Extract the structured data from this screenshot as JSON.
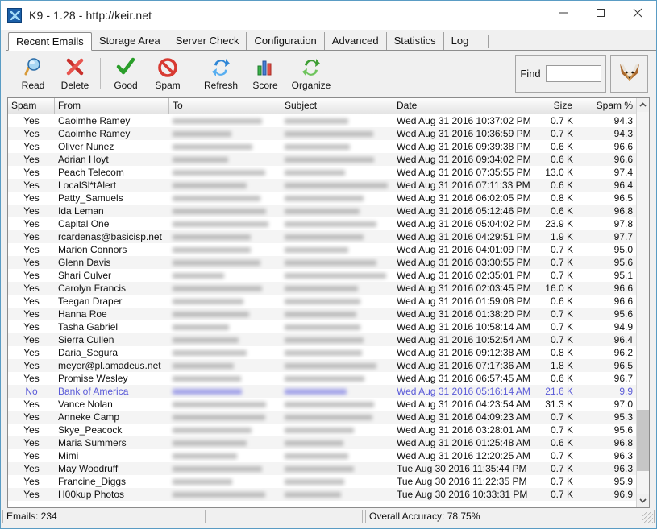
{
  "window": {
    "title": "K9 - 1.28 - http://keir.net",
    "app_icon": "k9-app-icon",
    "minimize_label": "Minimize",
    "maximize_label": "Maximize",
    "close_label": "Close"
  },
  "tabs": [
    {
      "label": "Recent Emails",
      "active": true
    },
    {
      "label": "Storage Area",
      "active": false
    },
    {
      "label": "Server Check",
      "active": false
    },
    {
      "label": "Configuration",
      "active": false
    },
    {
      "label": "Advanced",
      "active": false
    },
    {
      "label": "Statistics",
      "active": false
    },
    {
      "label": "Log",
      "active": false
    }
  ],
  "toolbar": {
    "buttons": [
      {
        "label": "Read",
        "icon": "magnifier-icon"
      },
      {
        "label": "Delete",
        "icon": "red-x-icon"
      },
      {
        "label": "Good",
        "icon": "green-check-icon"
      },
      {
        "label": "Spam",
        "icon": "red-prohibition-icon"
      },
      {
        "label": "Refresh",
        "icon": "blue-refresh-arrows-icon"
      },
      {
        "label": "Score",
        "icon": "bar-chart-icon"
      },
      {
        "label": "Organize",
        "icon": "green-recycle-arrows-icon"
      }
    ],
    "find_label": "Find",
    "find_value": "",
    "find_placeholder": "",
    "fox_icon": "fox-head-icon"
  },
  "table": {
    "columns": [
      "Spam",
      "From",
      "To",
      "Subject",
      "Date",
      "Size",
      "Spam %"
    ],
    "selected_color": "#5a5ad8",
    "rows": [
      {
        "spam": "Yes",
        "from": "Caoimhe Ramey",
        "to": "",
        "subject": "",
        "date": "Wed Aug 31 2016  10:37:02 PM",
        "size": "0.7 K",
        "spam_pct": "94.3",
        "selected": false
      },
      {
        "spam": "Yes",
        "from": "Caoimhe Ramey",
        "to": "",
        "subject": "",
        "date": "Wed Aug 31 2016  10:36:59 PM",
        "size": "0.7 K",
        "spam_pct": "94.3",
        "selected": false
      },
      {
        "spam": "Yes",
        "from": "Oliver Nunez",
        "to": "",
        "subject": "",
        "date": "Wed Aug 31 2016  09:39:38 PM",
        "size": "0.6 K",
        "spam_pct": "96.6",
        "selected": false
      },
      {
        "spam": "Yes",
        "from": "Adrian Hoyt",
        "to": "",
        "subject": "",
        "date": "Wed Aug 31 2016  09:34:02 PM",
        "size": "0.6 K",
        "spam_pct": "96.6",
        "selected": false
      },
      {
        "spam": "Yes",
        "from": "Peach Telecom",
        "to": "",
        "subject": "",
        "date": "Wed Aug 31 2016  07:35:55 PM",
        "size": "13.0 K",
        "spam_pct": "97.4",
        "selected": false
      },
      {
        "spam": "Yes",
        "from": "LocalSl*tAlert",
        "to": "",
        "subject": "",
        "date": "Wed Aug 31 2016  07:11:33 PM",
        "size": "0.6 K",
        "spam_pct": "96.4",
        "selected": false
      },
      {
        "spam": "Yes",
        "from": "Patty_Samuels",
        "to": "",
        "subject": "",
        "date": "Wed Aug 31 2016  06:02:05 PM",
        "size": "0.8 K",
        "spam_pct": "96.5",
        "selected": false
      },
      {
        "spam": "Yes",
        "from": "Ida Leman",
        "to": "",
        "subject": "",
        "date": "Wed Aug 31 2016  05:12:46 PM",
        "size": "0.6 K",
        "spam_pct": "96.8",
        "selected": false
      },
      {
        "spam": "Yes",
        "from": "Capital One",
        "to": "",
        "subject": "",
        "date": "Wed Aug 31 2016  05:04:02 PM",
        "size": "23.9 K",
        "spam_pct": "97.8",
        "selected": false
      },
      {
        "spam": "Yes",
        "from": "rcardenas@basicisp.net",
        "to": "",
        "subject": "",
        "date": "Wed Aug 31 2016  04:29:51 PM",
        "size": "1.9 K",
        "spam_pct": "97.7",
        "selected": false
      },
      {
        "spam": "Yes",
        "from": "Marion Connors",
        "to": "",
        "subject": "",
        "date": "Wed Aug 31 2016  04:01:09 PM",
        "size": "0.7 K",
        "spam_pct": "95.0",
        "selected": false
      },
      {
        "spam": "Yes",
        "from": "Glenn Davis",
        "to": "",
        "subject": "",
        "date": "Wed Aug 31 2016  03:30:55 PM",
        "size": "0.7 K",
        "spam_pct": "95.6",
        "selected": false
      },
      {
        "spam": "Yes",
        "from": "Shari Culver",
        "to": "",
        "subject": "",
        "date": "Wed Aug 31 2016  02:35:01 PM",
        "size": "0.7 K",
        "spam_pct": "95.1",
        "selected": false
      },
      {
        "spam": "Yes",
        "from": "Carolyn Francis",
        "to": "",
        "subject": "",
        "date": "Wed Aug 31 2016  02:03:45 PM",
        "size": "16.0 K",
        "spam_pct": "96.6",
        "selected": false
      },
      {
        "spam": "Yes",
        "from": "Teegan Draper",
        "to": "",
        "subject": "",
        "date": "Wed Aug 31 2016  01:59:08 PM",
        "size": "0.6 K",
        "spam_pct": "96.6",
        "selected": false
      },
      {
        "spam": "Yes",
        "from": "Hanna Roe",
        "to": "",
        "subject": "",
        "date": "Wed Aug 31 2016  01:38:20 PM",
        "size": "0.7 K",
        "spam_pct": "95.6",
        "selected": false
      },
      {
        "spam": "Yes",
        "from": "Tasha Gabriel",
        "to": "",
        "subject": "",
        "date": "Wed Aug 31 2016  10:58:14 AM",
        "size": "0.7 K",
        "spam_pct": "94.9",
        "selected": false
      },
      {
        "spam": "Yes",
        "from": "Sierra Cullen",
        "to": "",
        "subject": "",
        "date": "Wed Aug 31 2016  10:52:54 AM",
        "size": "0.7 K",
        "spam_pct": "96.4",
        "selected": false
      },
      {
        "spam": "Yes",
        "from": "Daria_Segura",
        "to": "",
        "subject": "",
        "date": "Wed Aug 31 2016  09:12:38 AM",
        "size": "0.8 K",
        "spam_pct": "96.2",
        "selected": false
      },
      {
        "spam": "Yes",
        "from": "meyer@pl.amadeus.net",
        "to": "",
        "subject": "",
        "date": "Wed Aug 31 2016  07:17:36 AM",
        "size": "1.8 K",
        "spam_pct": "96.5",
        "selected": false
      },
      {
        "spam": "Yes",
        "from": "Promise Wesley",
        "to": "",
        "subject": "",
        "date": "Wed Aug 31 2016  06:57:45 AM",
        "size": "0.6 K",
        "spam_pct": "96.7",
        "selected": false
      },
      {
        "spam": "No",
        "from": "Bank of America",
        "to": "",
        "subject": "",
        "date": "Wed Aug 31 2016  05:16:14 AM",
        "size": "21.6 K",
        "spam_pct": "9.9",
        "selected": true
      },
      {
        "spam": "Yes",
        "from": "Vance Nolan",
        "to": "",
        "subject": "",
        "date": "Wed Aug 31 2016  04:23:54 AM",
        "size": "31.3 K",
        "spam_pct": "97.0",
        "selected": false
      },
      {
        "spam": "Yes",
        "from": "Anneke Camp",
        "to": "",
        "subject": "",
        "date": "Wed Aug 31 2016  04:09:23 AM",
        "size": "0.7 K",
        "spam_pct": "95.3",
        "selected": false
      },
      {
        "spam": "Yes",
        "from": "Skye_Peacock",
        "to": "",
        "subject": "",
        "date": "Wed Aug 31 2016  03:28:01 AM",
        "size": "0.7 K",
        "spam_pct": "95.6",
        "selected": false
      },
      {
        "spam": "Yes",
        "from": "Maria Summers",
        "to": "",
        "subject": "",
        "date": "Wed Aug 31 2016  01:25:48 AM",
        "size": "0.6 K",
        "spam_pct": "96.8",
        "selected": false
      },
      {
        "spam": "Yes",
        "from": "Mimi",
        "to": "",
        "subject": "",
        "date": "Wed Aug 31 2016  12:20:25 AM",
        "size": "0.7 K",
        "spam_pct": "96.3",
        "selected": false
      },
      {
        "spam": "Yes",
        "from": "May Woodruff",
        "to": "",
        "subject": "",
        "date": "Tue Aug 30 2016  11:35:44 PM",
        "size": "0.7 K",
        "spam_pct": "96.3",
        "selected": false
      },
      {
        "spam": "Yes",
        "from": "Francine_Diggs",
        "to": "",
        "subject": "",
        "date": "Tue Aug 30 2016  11:22:35 PM",
        "size": "0.7 K",
        "spam_pct": "95.9",
        "selected": false
      },
      {
        "spam": "Yes",
        "from": "H00kup Photos",
        "to": "",
        "subject": "",
        "date": "Tue Aug 30 2016  10:33:31 PM",
        "size": "0.7 K",
        "spam_pct": "96.9",
        "selected": false
      }
    ]
  },
  "scrollbar": {
    "up_arrow": "chevron-up-icon",
    "down_arrow": "chevron-down-icon"
  },
  "statusbar": {
    "emails": "Emails: 234",
    "middle": "",
    "accuracy": "Overall Accuracy: 78.75%"
  }
}
